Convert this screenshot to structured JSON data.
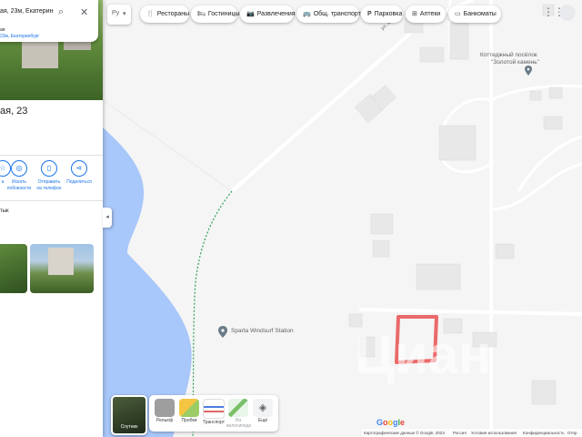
{
  "map": {
    "place_label": "Коттеджный посёлок",
    "place_label2": "\"Золотой камень\"",
    "poi_label": "Sparta Windsurf Station",
    "street_label": "ул. Кор",
    "watermark": "Циан",
    "google_logo": "Google",
    "colors": {
      "water": "#a8c7fa",
      "land": "#f5f5f5",
      "road": "#ffffff",
      "building": "#e8e8e8",
      "highlight": "#ea6a6a",
      "path": "#2e9e56"
    }
  },
  "panel": {
    "search_query": "ая, 23м, Екатеринб",
    "suggestion_line1": "ая",
    "suggestion_line2": "23м, Екатеринбург",
    "title": "ая, 23",
    "section_label": "тык",
    "actions": [
      {
        "icon": "save-icon",
        "label": "а"
      },
      {
        "icon": "nearby-icon",
        "label": "Искать поблизости"
      },
      {
        "icon": "send-icon",
        "label": "Отправить на телефон"
      },
      {
        "icon": "share-icon",
        "label": "Поделиться"
      }
    ]
  },
  "toolbar": {
    "lang": "Ру",
    "chips": [
      {
        "icon": "restaurant-icon",
        "glyph": "🍴",
        "label": "Рестораны"
      },
      {
        "icon": "hotel-icon",
        "glyph": "🛏",
        "label": "Гостиницы"
      },
      {
        "icon": "camera-icon",
        "glyph": "📷",
        "label": "Развлечения"
      },
      {
        "icon": "transit-icon",
        "glyph": "🚌",
        "label": "Общ. транспорт"
      },
      {
        "icon": "parking-icon",
        "glyph": "P",
        "label": "Парковка"
      },
      {
        "icon": "pharmacy-icon",
        "glyph": "⊞",
        "label": "Аптеки"
      },
      {
        "icon": "atm-icon",
        "glyph": "▭",
        "label": "Банкоматы"
      }
    ]
  },
  "layers": {
    "satellite_label": "Спутник",
    "options": [
      {
        "icon": "terrain-icon",
        "label": "Рельеф",
        "color": "#9e9e9e"
      },
      {
        "icon": "traffic-icon",
        "label": "Пробки",
        "color": "#f4c542"
      },
      {
        "icon": "transit-layer-icon",
        "label": "Транспорт",
        "color": "#4f7fe0"
      },
      {
        "icon": "bike-icon",
        "label": "На велосипеде",
        "color": "#7bbf6a"
      },
      {
        "icon": "more-layers-icon",
        "label": "Ещё",
        "color": "#e0e0e0"
      }
    ]
  },
  "footer": {
    "copyright": "Картографические данные © Google, 2023",
    "country": "Россия",
    "terms": "Условия использования",
    "privacy": "Конфиденциальность",
    "feedback": "Отпр"
  }
}
